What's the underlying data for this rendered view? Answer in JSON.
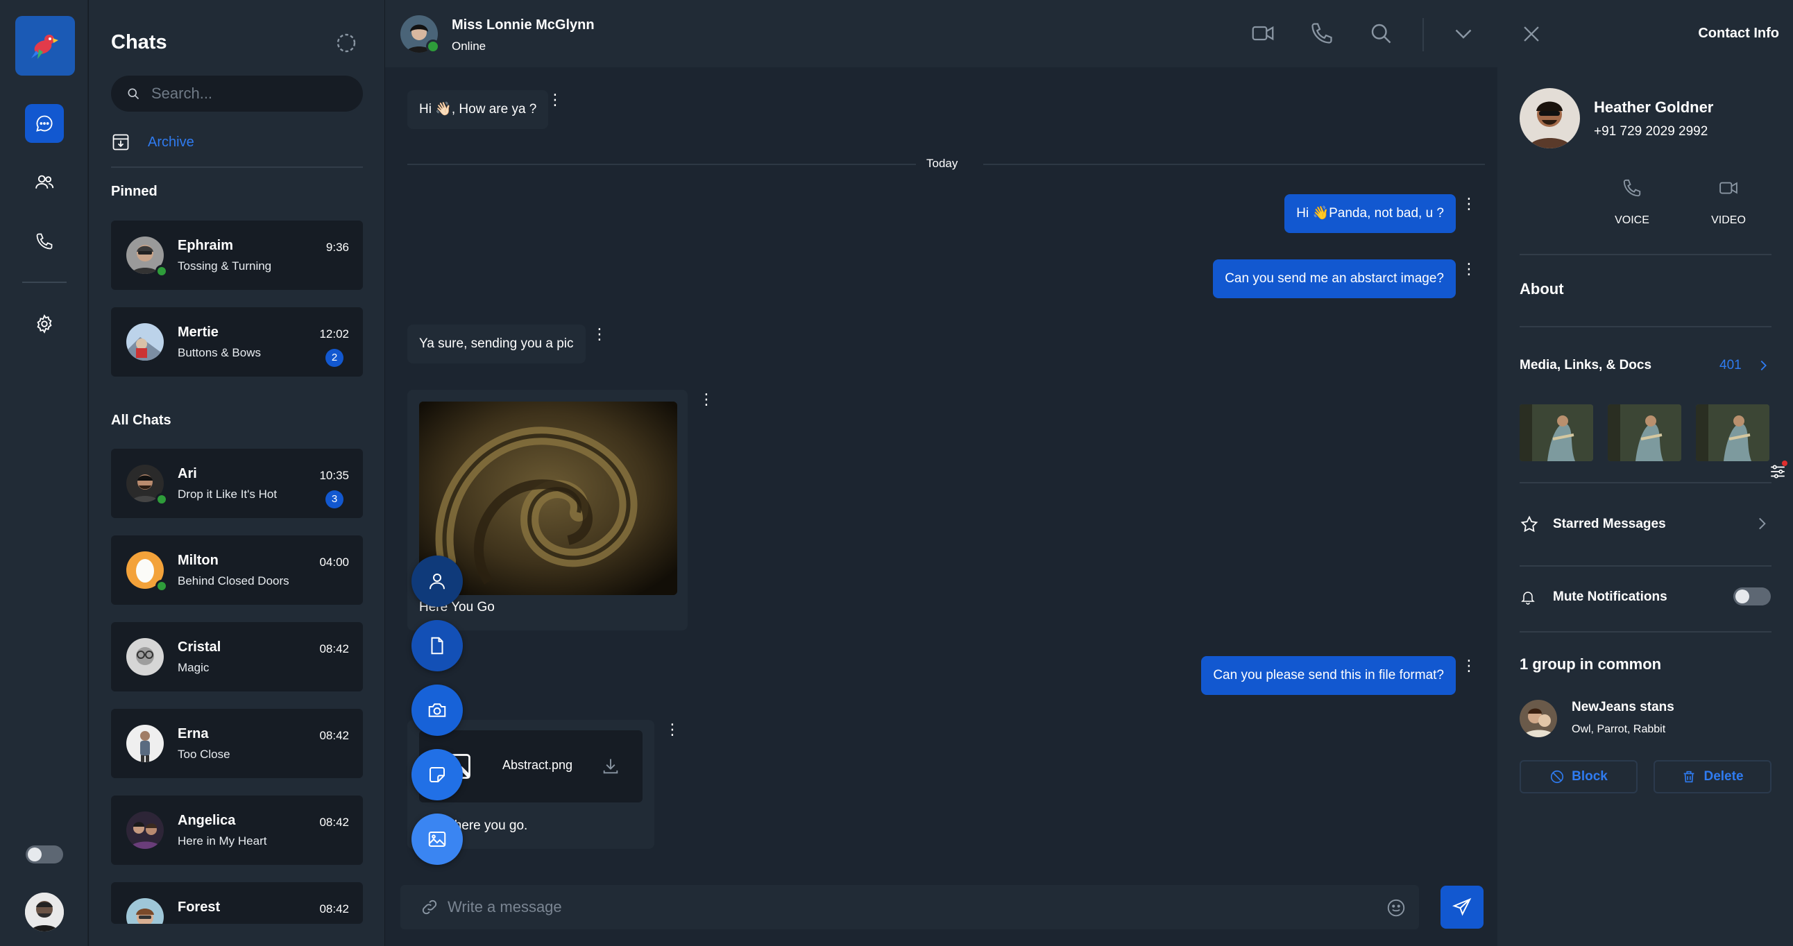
{
  "rail": {
    "toggle_state": "off"
  },
  "chatlist": {
    "title": "Chats",
    "search_placeholder": "Search...",
    "archive_label": "Archive",
    "pinned_heading": "Pinned",
    "all_heading": "All Chats",
    "pinned": [
      {
        "name": "Ephraim",
        "preview": "Tossing & Turning",
        "time": "9:36",
        "badge": "",
        "online": true
      },
      {
        "name": "Mertie",
        "preview": "Buttons & Bows",
        "time": "12:02",
        "badge": "2",
        "online": false
      }
    ],
    "all": [
      {
        "name": "Ari",
        "preview": "Drop it Like It's Hot",
        "time": "10:35",
        "badge": "3",
        "online": true
      },
      {
        "name": "Milton",
        "preview": "Behind Closed Doors",
        "time": "04:00",
        "badge": "",
        "online": true
      },
      {
        "name": "Cristal",
        "preview": "Magic",
        "time": "08:42",
        "badge": "",
        "online": false
      },
      {
        "name": "Erna",
        "preview": "Too Close",
        "time": "08:42",
        "badge": "",
        "online": false
      },
      {
        "name": "Angelica",
        "preview": "Here in My Heart",
        "time": "08:42",
        "badge": "",
        "online": false
      },
      {
        "name": "Forest",
        "preview": "",
        "time": "08:42",
        "badge": "",
        "online": false
      }
    ]
  },
  "chat": {
    "contact_name": "Miss Lonnie McGlynn",
    "contact_status": "Online",
    "day_divider": "Today",
    "messages": {
      "m1": "Hi 👋🏻, How are ya ?",
      "m2": "Hi 👋Panda, not bad, u ?",
      "m3": "Can you send me an abstarct image?",
      "m4": "Ya sure, sending you a pic",
      "m5_caption": "Here You Go",
      "m6": "Can you please send this in file format?",
      "m7_file": "Abstract.png",
      "m7_caption": "Sure, here you go."
    },
    "composer_placeholder": "Write a message"
  },
  "info": {
    "title": "Contact Info",
    "name": "Heather Goldner",
    "phone": "+91 729 2029 2992",
    "voice_label": "VOICE",
    "video_label": "VIDEO",
    "about_heading": "About",
    "media_label": "Media, Links, & Docs",
    "media_count": "401",
    "starred_label": "Starred Messages",
    "mute_label": "Mute Notifications",
    "mute_state": "off",
    "groups_heading": "1 group in common",
    "group_name": "NewJeans stans",
    "group_members": "Owl, Parrot, Rabbit",
    "block_label": "Block",
    "delete_label": "Delete"
  },
  "colors": {
    "accent": "#1258d0",
    "link": "#2f7bf0",
    "panel": "#212b36",
    "background": "#1c2530",
    "online": "#2e9c3a"
  }
}
